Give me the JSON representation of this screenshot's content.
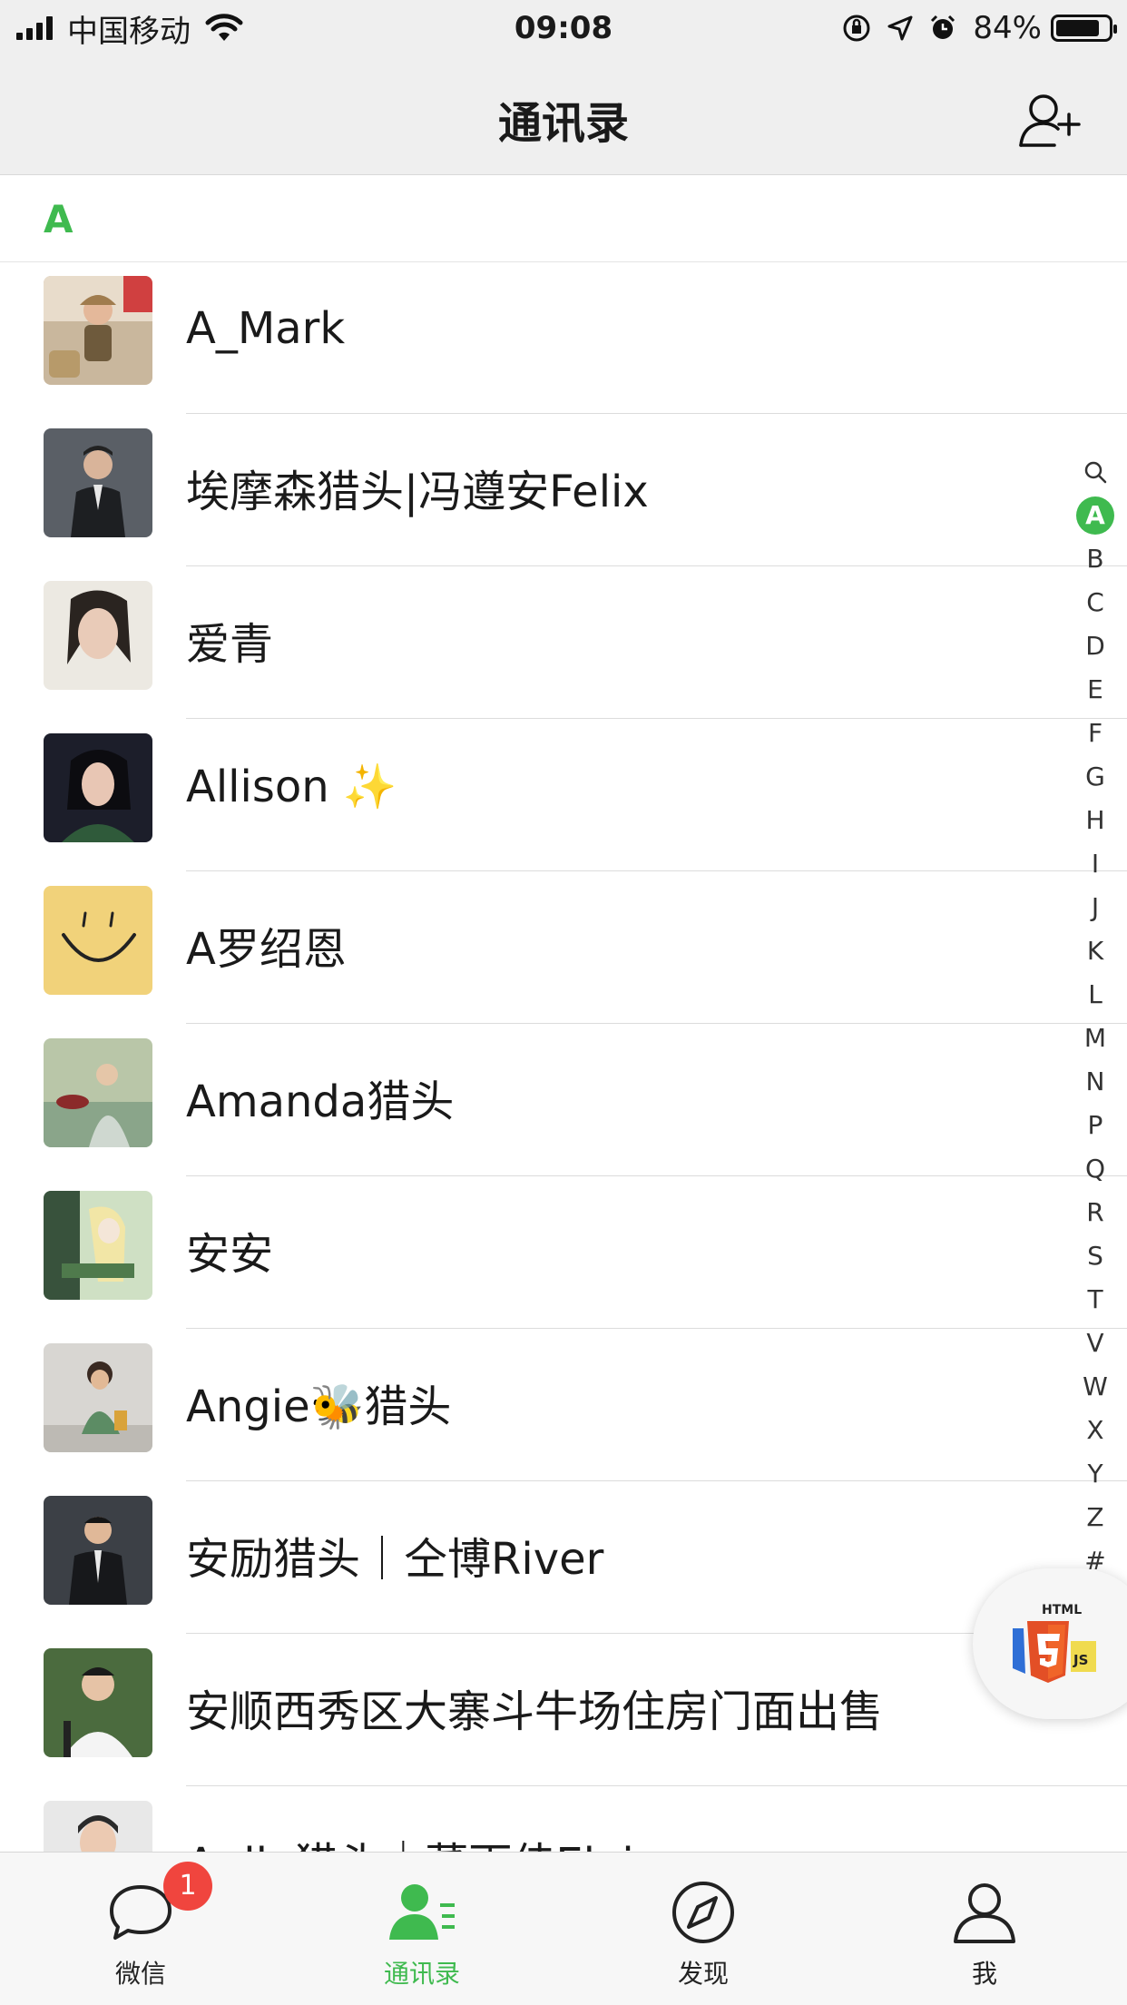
{
  "status_bar": {
    "carrier": "中国移动",
    "time": "09:08",
    "battery": "84%",
    "battery_level": 0.84,
    "icons": [
      "signal-icon",
      "wifi-icon",
      "orientation-lock-icon",
      "location-icon",
      "alarm-icon",
      "battery-icon"
    ]
  },
  "nav": {
    "title": "通讯录",
    "add_icon": "add-friend-icon"
  },
  "section": {
    "letter": "A"
  },
  "contacts": [
    {
      "name": "A_Mark"
    },
    {
      "name": "埃摩森猎头|冯遵安Felix"
    },
    {
      "name": "爱青"
    },
    {
      "name": "Allison ✨"
    },
    {
      "name": "A罗绍恩"
    },
    {
      "name": "Amanda猎头"
    },
    {
      "name": "安安"
    },
    {
      "name": "Angie🐝猎头"
    },
    {
      "name": "安励猎头｜仝博River"
    },
    {
      "name": "安顺西秀区大寨斗牛场住房门面出售"
    },
    {
      "name": "Anlla猎头｜董雨佳Elaine"
    }
  ],
  "index": [
    "search",
    "A",
    "B",
    "C",
    "D",
    "E",
    "F",
    "G",
    "H",
    "I",
    "J",
    "K",
    "L",
    "M",
    "N",
    "P",
    "Q",
    "R",
    "S",
    "T",
    "V",
    "W",
    "X",
    "Y",
    "Z",
    "#"
  ],
  "index_active": "A",
  "floating": {
    "icon": "html5-js-icon"
  },
  "tabs": [
    {
      "label": "微信",
      "icon": "chat-icon",
      "badge": "1"
    },
    {
      "label": "通讯录",
      "icon": "contacts-icon",
      "active": true
    },
    {
      "label": "发现",
      "icon": "compass-icon"
    },
    {
      "label": "我",
      "icon": "me-icon"
    }
  ],
  "colors": {
    "accent": "#3fba4f",
    "badge": "#f0453e",
    "bar": "#efefef"
  }
}
